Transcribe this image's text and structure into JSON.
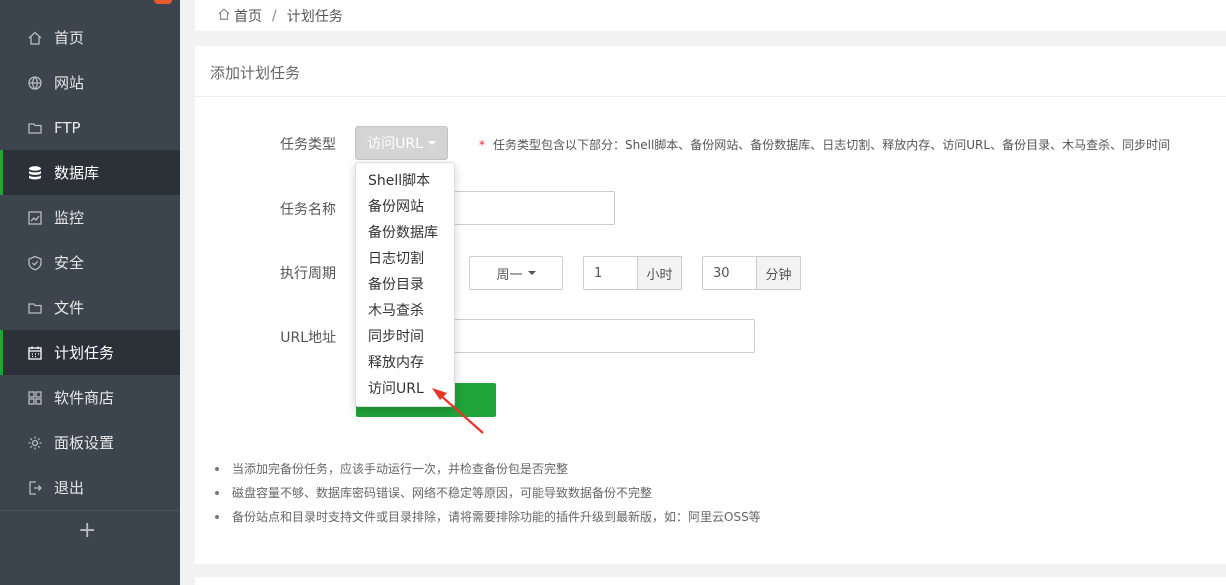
{
  "sidebar": {
    "items": [
      {
        "label": "首页",
        "icon": "home-icon"
      },
      {
        "label": "网站",
        "icon": "globe-icon"
      },
      {
        "label": "FTP",
        "icon": "folder-ftp-icon"
      },
      {
        "label": "数据库",
        "icon": "database-icon"
      },
      {
        "label": "监控",
        "icon": "monitor-icon"
      },
      {
        "label": "安全",
        "icon": "shield-icon"
      },
      {
        "label": "文件",
        "icon": "folder-icon"
      },
      {
        "label": "计划任务",
        "icon": "calendar-icon"
      },
      {
        "label": "软件商店",
        "icon": "grid-icon"
      },
      {
        "label": "面板设置",
        "icon": "gear-icon"
      },
      {
        "label": "退出",
        "icon": "logout-icon"
      }
    ],
    "add_label": "+"
  },
  "breadcrumb": {
    "home": "首页",
    "separator": "/",
    "current": "计划任务"
  },
  "card": {
    "title": "添加计划任务"
  },
  "form": {
    "task_type_label": "任务类型",
    "task_type_value": "访问URL",
    "task_type_hint_star": "*",
    "task_type_hint": "任务类型包含以下部分：Shell脚本、备份网站、备份数据库、日志切割、释放内存、访问URL、备份目录、木马查杀、同步时间",
    "task_name_label": "任务名称",
    "period_label": "执行周期",
    "weekday_value": "周一",
    "hour_value": "1",
    "hour_unit": "小时",
    "minute_value": "30",
    "minute_unit": "分钟",
    "url_label": "URL地址"
  },
  "dropdown": {
    "items": [
      "Shell脚本",
      "备份网站",
      "备份数据库",
      "日志切割",
      "备份目录",
      "木马查杀",
      "同步时间",
      "释放内存",
      "访问URL"
    ]
  },
  "notes": [
    "当添加完备份任务，应该手动运行一次，并检查备份包是否完整",
    "磁盘容量不够、数据库密码错误、网络不稳定等原因，可能导致数据备份不完整",
    "备份站点和目录时支持文件或目录排除，请将需要排除功能的插件升级到最新版，如：阿里云OSS等"
  ],
  "colors": {
    "accent": "#20a53a",
    "sidebar": "#3c444d",
    "annotation": "#e8352b"
  }
}
